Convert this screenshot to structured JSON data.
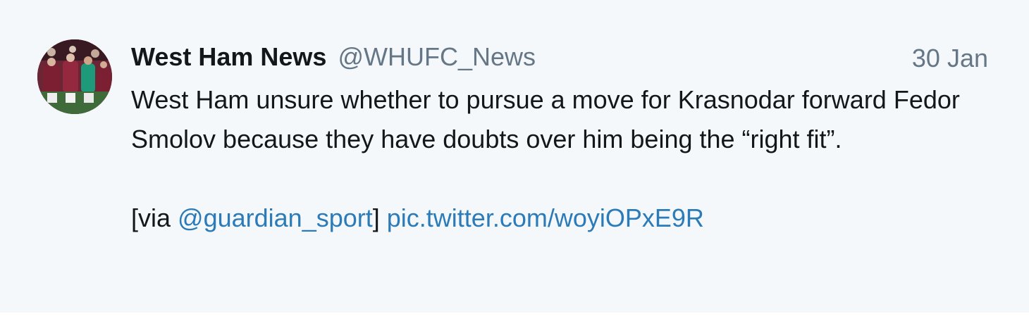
{
  "tweet": {
    "author": {
      "display_name": "West Ham News",
      "handle": "@WHUFC_News",
      "avatar_icon": "team-photo-avatar"
    },
    "timestamp": "30 Jan",
    "text": "West Ham unsure whether to pursue a move for Krasnodar forward Fedor Smolov because they have doubts over him being the “right fit”.",
    "via_prefix": "[via ",
    "mention": "@guardian_sport",
    "via_suffix": "]",
    "media_link": "pic.twitter.com/woyiOPxE9R"
  },
  "colors": {
    "background": "#f5f8fa",
    "text": "#14171a",
    "secondary": "#657786",
    "link": "#2b7bb9"
  }
}
